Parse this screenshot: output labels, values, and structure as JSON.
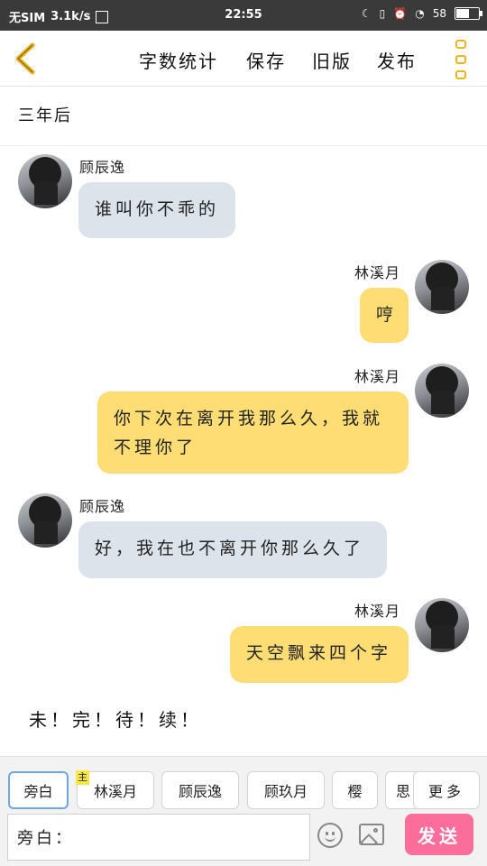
{
  "status_bar": {
    "carrier": "无SIM",
    "speed": "3.1k/s",
    "time": "22:55",
    "battery": "58"
  },
  "toolbar": {
    "word_count": "字数统计",
    "save": "保存",
    "old_version": "旧版",
    "publish": "发布"
  },
  "chapter_title": "三年后",
  "messages": [
    {
      "name": "顾辰逸",
      "text": "谁叫你不乖的",
      "side": "left"
    },
    {
      "name": "林溪月",
      "text": "哼",
      "side": "right"
    },
    {
      "name": "林溪月",
      "text": "你下次在离开我那么久，我就不理你了",
      "side": "right"
    },
    {
      "name": "顾辰逸",
      "text": "好，我在也不离开你那么久了",
      "side": "left"
    },
    {
      "name": "林溪月",
      "text": "天空飘来四个字",
      "side": "right"
    }
  ],
  "ending": "未！完！待！续！",
  "roles": {
    "narration": "旁白",
    "host_tag": "主",
    "items": [
      "林溪月",
      "顾辰逸",
      "顾玖月",
      "樱",
      "思"
    ],
    "more": "更多"
  },
  "input": {
    "value": "旁白："
  },
  "send_label": "发送",
  "colors": {
    "accent_yellow": "#f0b41e",
    "bubble_yellow": "#fedd74",
    "bubble_gray": "#dde3ea",
    "send_pink": "#fb6d9a",
    "active_blue": "#6fa6de"
  }
}
